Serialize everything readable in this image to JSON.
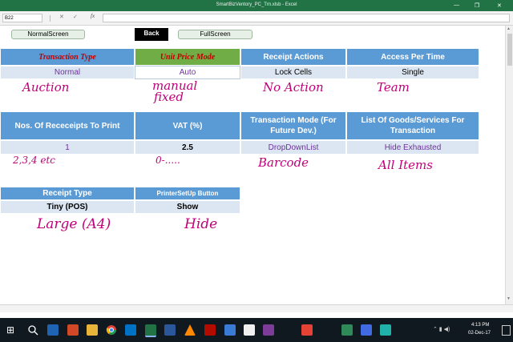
{
  "window": {
    "title": "SmartBizVentory_PC_Trn.xlsb - Excel",
    "minimize_glyph": "—",
    "restore_glyph": "❐",
    "close_glyph": "✕"
  },
  "formula_bar": {
    "name_box": "B22",
    "cancel_glyph": "✕",
    "enter_glyph": "✓",
    "fx_label": "fx",
    "value": ""
  },
  "toolbar": {
    "normal_screen": "NormalScreen",
    "back": "Back",
    "full_screen": "FullScreen"
  },
  "table1": {
    "headers": [
      "Transaction Type",
      "Unit Price Mode",
      "Receipt Actions",
      "Access Per Time"
    ],
    "values": [
      "Normal",
      "Auto",
      "Lock Cells",
      "Single"
    ],
    "notes": [
      "Auction",
      "manual",
      "fixed",
      "No Action",
      "Team"
    ]
  },
  "table2": {
    "headers": [
      "Nos. Of Receceipts To Print",
      "VAT (%)",
      "Transaction Mode (For Future Dev.)",
      "List Of Goods/Services For Transaction"
    ],
    "values": [
      "1",
      "2.5",
      "DropDownList",
      "Hide Exhausted"
    ],
    "notes": [
      "2,3,4 etc",
      "0-.....",
      "Barcode",
      "All Items"
    ]
  },
  "table3": {
    "headers": [
      "Receipt Type",
      "PrinterSetUp Button"
    ],
    "values": [
      "Tiny (POS)",
      "Show"
    ],
    "notes": [
      "Large (A4)",
      "Hide"
    ]
  },
  "taskbar": {
    "time": "4:13 PM",
    "date": "02-Dec-17",
    "icons": [
      "windows-start-icon",
      "search-icon",
      "task-view-icon",
      "store-icon",
      "powerpoint-icon",
      "folder-icon",
      "chrome-icon",
      "outlook-icon",
      "excel-icon",
      "word-icon",
      "vlc-icon",
      "acrobat-icon",
      "pdf-icon",
      "explorer-icon",
      "notepad-icon"
    ]
  },
  "colors": {
    "header_blue": "#5b9bd5",
    "header_green": "#70ad47",
    "value_fill": "#dce6f2",
    "handwriting": "#c00078",
    "purple_text": "#7030a0",
    "excel_green": "#217346"
  }
}
